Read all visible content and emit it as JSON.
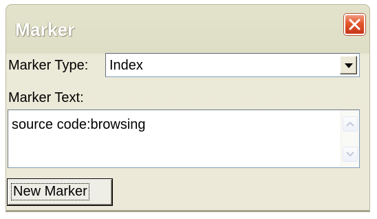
{
  "window": {
    "title": "Marker"
  },
  "marker_type": {
    "label": "Marker Type:",
    "selected": "Index"
  },
  "marker_text": {
    "label": "Marker Text:",
    "value": "source code:browsing"
  },
  "buttons": {
    "new_marker": "New Marker"
  },
  "icons": {
    "close": "close-icon",
    "dropdown": "chevron-down-icon",
    "scroll_up": "scroll-up-icon",
    "scroll_down": "scroll-down-icon"
  },
  "colors": {
    "close_button": "#e4562a",
    "window_face": "#ece9d8",
    "title_text": "#ffffff"
  }
}
